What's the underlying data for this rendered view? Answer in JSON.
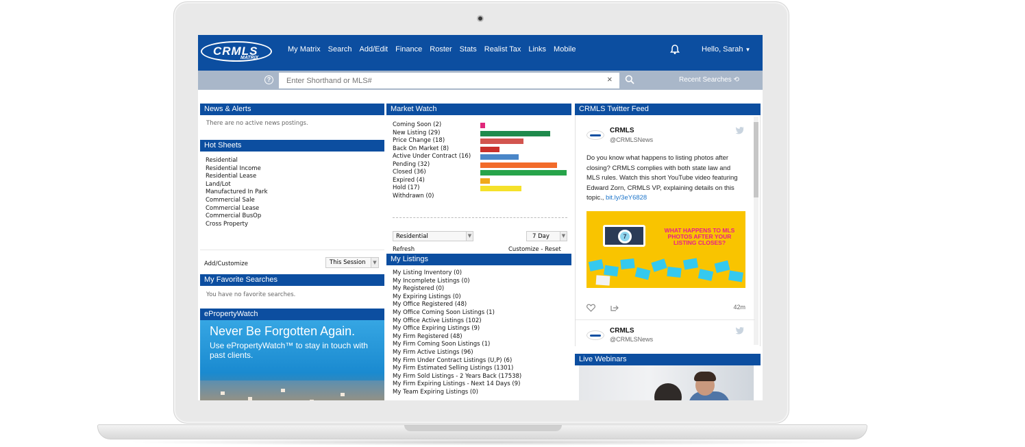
{
  "brand": {
    "logo_text": "CRMLS",
    "logo_sub": "MATRIX",
    "primary": "#0c4ea0",
    "searchbar_bg": "#a9b7c9"
  },
  "nav": {
    "links": [
      "My Matrix",
      "Search",
      "Add/Edit",
      "Finance",
      "Roster",
      "Stats",
      "Realist Tax",
      "Links",
      "Mobile"
    ],
    "greeting": "Hello, Sarah",
    "bell_icon": "bell-icon"
  },
  "search": {
    "placeholder": "Enter Shorthand or MLS#",
    "help_glyph": "?",
    "clear_glyph": "×",
    "recent_label": "Recent Searches"
  },
  "news": {
    "title": "News & Alerts",
    "empty": "There are no active news postings."
  },
  "hot_sheets": {
    "title": "Hot Sheets",
    "items": [
      "Residential",
      "Residential Income",
      "Residential Lease",
      "Land/Lot",
      "Manufactured In Park",
      "Commercial Sale",
      "Commercial Lease",
      "Commercial BusOp",
      "Cross Property"
    ],
    "add_label": "Add/Customize",
    "session_value": "This Session"
  },
  "favorites": {
    "title": "My Favorite Searches",
    "empty": "You have no favorite searches."
  },
  "eproperty": {
    "title": "ePropertyWatch",
    "headline": "Never Be Forgotten Again.",
    "sub": "Use ePropertyWatch™ to stay in touch with past clients."
  },
  "market_watch": {
    "title": "Market Watch",
    "rows": [
      {
        "label": "Coming Soon (2)",
        "value": 2,
        "color": "#e0287a"
      },
      {
        "label": "New Listing (29)",
        "value": 29,
        "color": "#1f8a4c"
      },
      {
        "label": "Price Change (18)",
        "value": 18,
        "color": "#d2554f"
      },
      {
        "label": "Back On Market (8)",
        "value": 8,
        "color": "#c9302c"
      },
      {
        "label": "Active Under Contract (16)",
        "value": 16,
        "color": "#4a86c8"
      },
      {
        "label": "Pending (32)",
        "value": 32,
        "color": "#f26b2a"
      },
      {
        "label": "Closed (36)",
        "value": 36,
        "color": "#27a44a"
      },
      {
        "label": "Expired (4)",
        "value": 4,
        "color": "#f0a91b"
      },
      {
        "label": "Hold (17)",
        "value": 17,
        "color": "#f5e12a"
      },
      {
        "label": "Withdrawn (0)",
        "value": 0,
        "color": "#999999"
      }
    ],
    "max_value": 36,
    "property_type": "Residential",
    "period": "7 Day",
    "refresh_label": "Refresh",
    "customize_label": "Customize - Reset"
  },
  "my_listings": {
    "title": "My Listings",
    "items": [
      "My Listing Inventory (0)",
      "My Incomplete Listings  (0)",
      "My Registered (0)",
      "My Expiring Listings (0)",
      "My Office Registered (48)",
      "My Office Coming Soon Listings (1)",
      "My Office Active Listings (102)",
      "My Office Expiring Listings (9)",
      "My Firm Registered (48)",
      "My Firm Coming Soon Listings (1)",
      "My Firm Active Listings (96)",
      "My Firm Under Contract Listings (U,P) (6)",
      "My Firm Estimated Selling Listings (1301)",
      "My Firm Sold Listings - 2 Years Back  (17538)",
      "My Firm Expiring Listings - Next 14 Days (9)",
      "My Team Expiring Listings (0)"
    ]
  },
  "twitter": {
    "title": "CRMLS Twitter Feed",
    "tweets": [
      {
        "name": "CRMLS",
        "handle": "@CRMLSNews",
        "text": "Do you know what happens to listing photos after closing? CRMLS complies with both state law and MLS rules. Watch this short YouTube video featuring Edward Zorn, CRMLS VP, explaining details on this topic.",
        "link": "bit.ly/3eY6828",
        "image_text": "WHAT HAPPENS TO MLS PHOTOS AFTER YOUR LISTING CLOSES?",
        "image_number": "7",
        "time": "42m"
      },
      {
        "name": "CRMLS",
        "handle": "@CRMLSNews"
      }
    ]
  },
  "webinars": {
    "title": "Live Webinars"
  }
}
